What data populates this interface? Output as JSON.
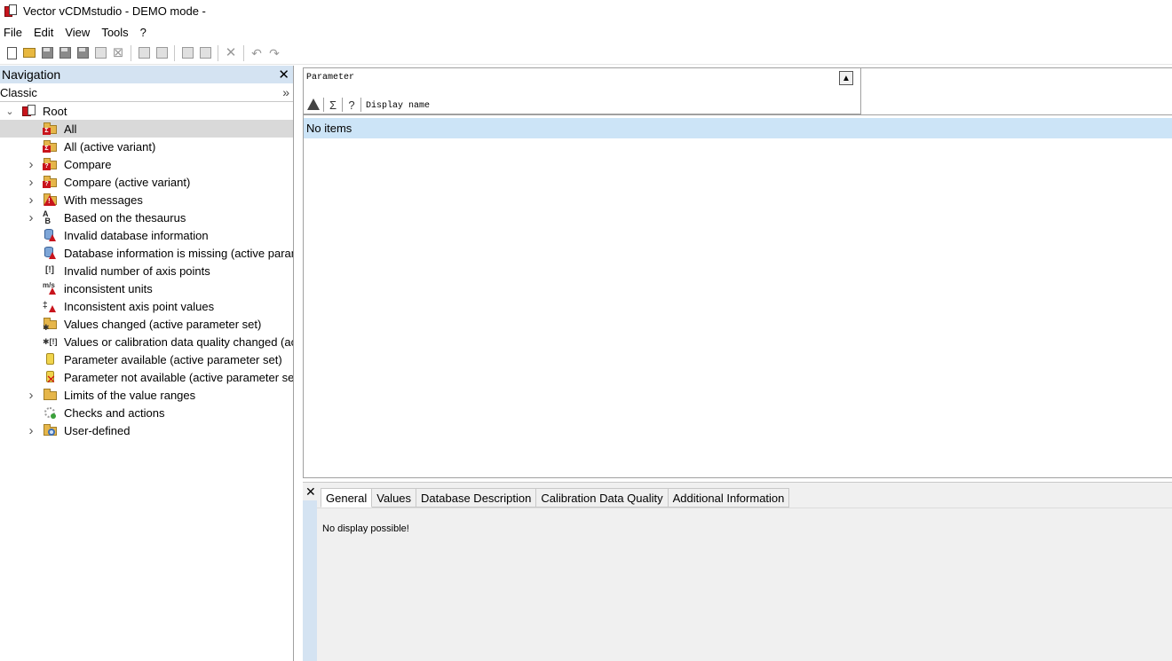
{
  "window": {
    "title": "Vector vCDMstudio - DEMO mode -"
  },
  "menu": {
    "items": [
      "File",
      "Edit",
      "View",
      "Tools",
      "?"
    ]
  },
  "toolbar": {
    "buttons": [
      "new-icon",
      "open-icon",
      "save-icon",
      "save-all-icon",
      "save-as-icon",
      "export-icon",
      "close-file-icon",
      "import-icon",
      "import-alt-icon",
      "copy-icon",
      "paste-icon",
      "delete-icon",
      "undo-icon",
      "redo-icon"
    ]
  },
  "navigation": {
    "title": "Navigation",
    "close_glyph": "✕",
    "view_mode": "Classic",
    "collapse_glyph": "»",
    "tree": {
      "root": {
        "label": "Root",
        "expanded": true
      },
      "items": [
        {
          "label": "All",
          "selected": true,
          "expandable": false,
          "icon": "folder-all-icon"
        },
        {
          "label": "All (active variant)",
          "expandable": false,
          "icon": "folder-all-variant-icon"
        },
        {
          "label": "Compare",
          "expandable": true,
          "icon": "folder-compare-icon"
        },
        {
          "label": "Compare (active variant)",
          "expandable": true,
          "icon": "folder-compare-variant-icon"
        },
        {
          "label": "With messages",
          "expandable": true,
          "icon": "folder-messages-icon"
        },
        {
          "label": "Based on the thesaurus",
          "expandable": true,
          "icon": "thesaurus-icon"
        },
        {
          "label": "Invalid database information",
          "expandable": false,
          "icon": "database-warning-icon"
        },
        {
          "label": "Database information is missing (active parameter set)",
          "expandable": false,
          "icon": "database-missing-icon"
        },
        {
          "label": "Invalid number of axis points",
          "expandable": false,
          "icon": "axis-points-icon"
        },
        {
          "label": "inconsistent units",
          "expandable": false,
          "icon": "units-warning-icon"
        },
        {
          "label": "Inconsistent axis point values",
          "expandable": false,
          "icon": "axis-values-warning-icon"
        },
        {
          "label": "Values changed (active parameter set)",
          "expandable": false,
          "icon": "folder-values-changed-icon"
        },
        {
          "label": "Values or calibration data quality changed (active parameter set)",
          "expandable": false,
          "icon": "quality-changed-icon"
        },
        {
          "label": "Parameter available (active parameter set)",
          "expandable": false,
          "icon": "parameter-available-icon"
        },
        {
          "label": "Parameter not available (active parameter set)",
          "expandable": false,
          "icon": "parameter-not-available-icon"
        },
        {
          "label": "Limits of the value ranges",
          "expandable": true,
          "icon": "folder-limits-icon"
        },
        {
          "label": "Checks and actions",
          "expandable": false,
          "icon": "checks-icon"
        },
        {
          "label": "User-defined",
          "expandable": true,
          "icon": "user-defined-icon"
        }
      ]
    }
  },
  "parameter_list": {
    "column_label": "Parameter",
    "sort_glyph": "▲",
    "filter_row": {
      "sigma": "Σ",
      "question": "?",
      "display_name": "Display name"
    },
    "empty_text": "No items"
  },
  "details": {
    "close_glyph": "✕",
    "tabs": [
      "General",
      "Values",
      "Database Description",
      "Calibration Data Quality",
      "Additional Information"
    ],
    "active_tab": "General",
    "message": "No display possible!"
  }
}
